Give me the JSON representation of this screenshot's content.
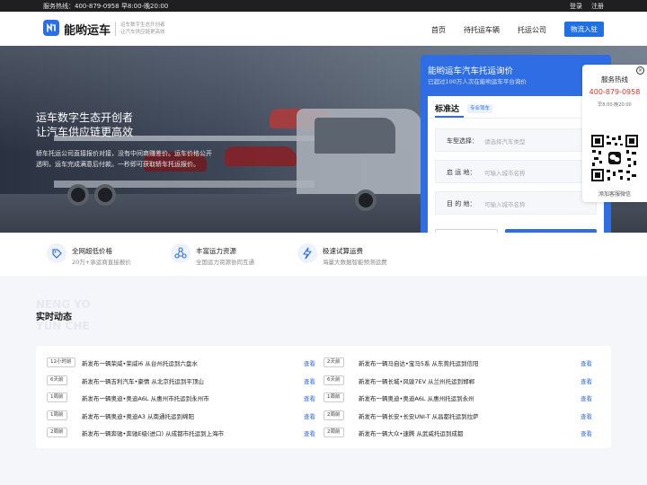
{
  "topbar": {
    "hotline": "服务热线：400-879-0958 早8:00-晚20:00",
    "login": "登录",
    "register": "注册"
  },
  "header": {
    "brand": "能哟运车",
    "slogan_line1": "运车数字生态开创者",
    "slogan_line2": "让汽车供应链更高效",
    "nav": [
      "首页",
      "待托运车辆",
      "托运公司"
    ],
    "join_button": "物流入驻"
  },
  "hero": {
    "title_line1": "运车数字生态开创者",
    "title_line2": "让汽车供应链更高效",
    "desc_line1": "轿车托运公司直接报价对接，没有中间商赚差价。运车价格公开",
    "desc_line2": "透明，运车完成满意后付款。一秒即可获取轿车托运报价。"
  },
  "quote": {
    "title": "能哟运车汽车托运询价",
    "subtitle": "已超过100万人次在能哟运车平台询价",
    "tab": "标准达",
    "tab_badge": "专业驾车",
    "fields": [
      {
        "label": "车型选择：",
        "placeholder": "请选择汽车类型"
      },
      {
        "label": "启  运  地：",
        "placeholder": "可输入城市名称"
      },
      {
        "label": "目  的  地：",
        "placeholder": "可输入城市名称"
      }
    ],
    "order_button": "下单托运",
    "price_button": "试算价格"
  },
  "hotline_card": {
    "title": "服务热线",
    "phone": "400-879-0958",
    "hours": "早8:00-晚20:00",
    "caption": "添加客服微信"
  },
  "features": [
    {
      "icon": "tag-icon",
      "title": "全网超低价格",
      "sub": "20万+承运商直接报价"
    },
    {
      "icon": "network-icon",
      "title": "丰富运力资源",
      "sub": "全国运力资源协同互通"
    },
    {
      "icon": "lightning-icon",
      "title": "极速试算运费",
      "sub": "海量大数据智能预测运费"
    }
  ],
  "news": {
    "en_line1": "NENG YO",
    "en_line2": "YUN CHE",
    "title": "实时动态",
    "link_label": "查看",
    "left": [
      {
        "time": "12小时前",
        "text": "新发布一辆荣威•荣威i6 从台州托运到六盘水"
      },
      {
        "time": "6天前",
        "text": "新发布一辆吉利汽车•豪情 从北京托运到平顶山"
      },
      {
        "time": "1周前",
        "text": "新发布一辆奥迪•奥迪A6L 从惠州市托运到永州市"
      },
      {
        "time": "1周前",
        "text": "新发布一辆奥迪•奥迪A3 从南通托运到绵阳"
      },
      {
        "time": "2周前",
        "text": "新发布一辆奔驰•奔驰E级(进口) 从成都市托运到上海市"
      }
    ],
    "right": [
      {
        "time": "2天前",
        "text": "新发布一辆马自达•宝马5系 从东莞托运到信阳"
      },
      {
        "time": "6天前",
        "text": "新发布一辆长城•风骏7EV 从兰州托运到邯郸"
      },
      {
        "time": "1周前",
        "text": "新发布一辆奥迪•奥迪A6L 从惠州托运到永州"
      },
      {
        "time": "2周前",
        "text": "新发布一辆长安•长安UNI-T 从昌都托运到拉萨"
      },
      {
        "time": "2周前",
        "text": "新发布一辆大众•速腾 从武威托运到成都"
      }
    ]
  },
  "colors": {
    "brand_blue": "#2f6de4",
    "phone_red": "#e3322e",
    "topbar": "#1f1f22"
  }
}
